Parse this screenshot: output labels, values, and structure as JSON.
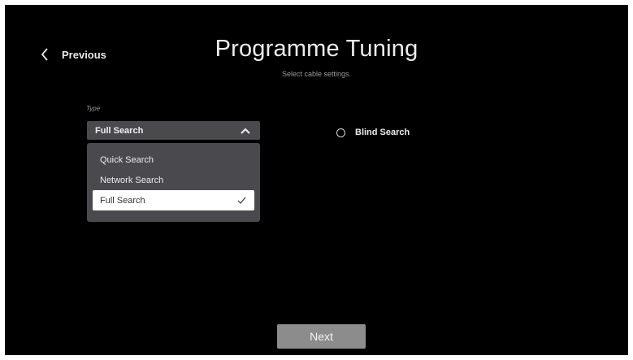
{
  "header": {
    "back_label": "Previous",
    "title": "Programme Tuning",
    "subtitle": "Select cable settings."
  },
  "type_field": {
    "label": "Type",
    "selected_value": "Full Search",
    "options": [
      {
        "label": "Quick Search",
        "selected": false
      },
      {
        "label": "Network Search",
        "selected": false
      },
      {
        "label": "Full Search",
        "selected": true
      }
    ]
  },
  "blind_search": {
    "label": "Blind Search",
    "checked": false
  },
  "footer": {
    "next_label": "Next"
  },
  "colors": {
    "background": "#000000",
    "panel": "#4a4a4e",
    "selected_option_bg": "#ffffff",
    "next_button": "#8c8c8c"
  },
  "icons": [
    "chevron-left-icon",
    "chevron-up-icon",
    "checkmark-icon",
    "radio-button-icon"
  ]
}
